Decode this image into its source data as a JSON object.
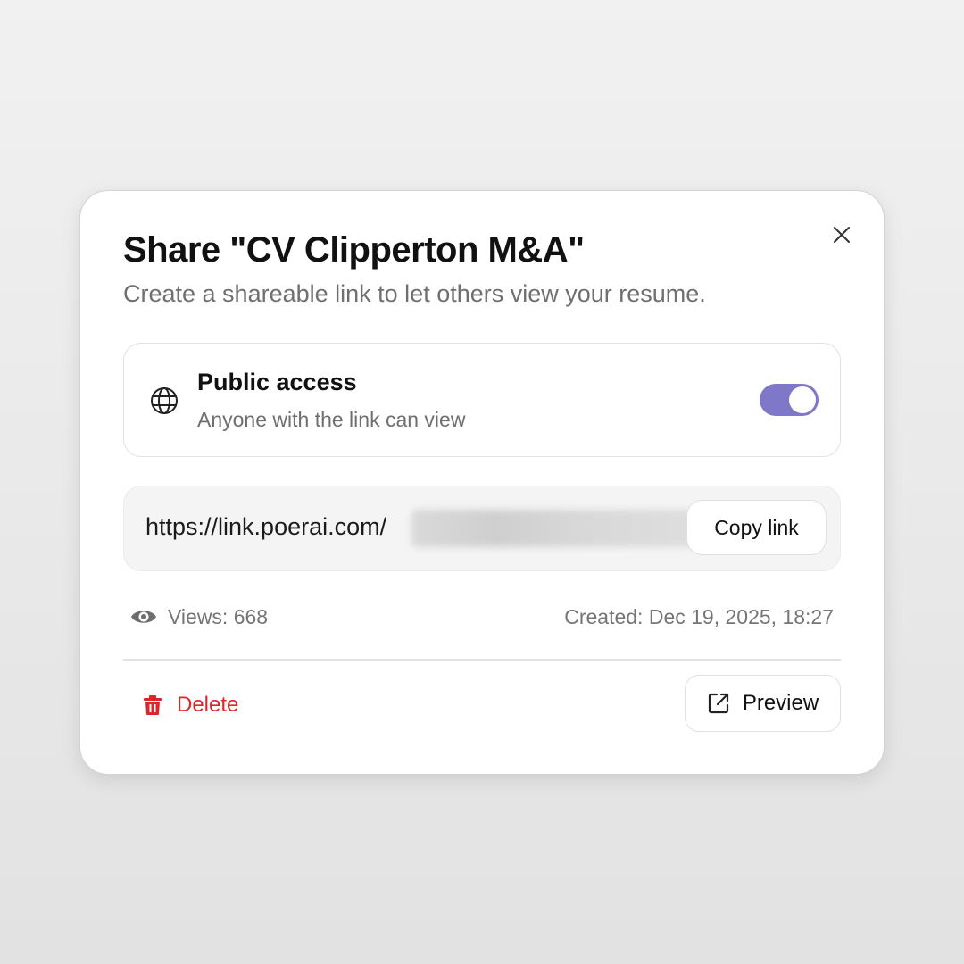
{
  "dialog": {
    "title": "Share \"CV Clipperton M&A\"",
    "subtitle": "Create a shareable link to let others view your resume.",
    "close_icon": "close-icon"
  },
  "public_access": {
    "icon": "globe-icon",
    "title": "Public access",
    "description": "Anyone with the link can view",
    "toggle_on": true,
    "toggle_color": "#7f78c9"
  },
  "share_link": {
    "url_visible": "https://link.poerai.com/",
    "copy_label": "Copy link"
  },
  "stats": {
    "eye_icon": "eye-icon",
    "views": "Views: 668",
    "created": "Created: Dec 19, 2025, 18:27"
  },
  "actions": {
    "delete_icon": "trash-icon",
    "delete_label": "Delete",
    "delete_color": "#e0242a",
    "preview_icon": "external-link-icon",
    "preview_label": "Preview"
  }
}
